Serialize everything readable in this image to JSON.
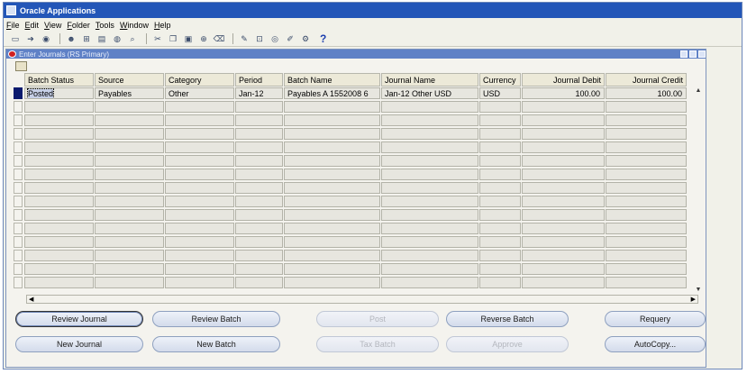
{
  "app": {
    "title": "Oracle Applications"
  },
  "menu": [
    "File",
    "Edit",
    "View",
    "Folder",
    "Tools",
    "Window",
    "Help"
  ],
  "toolbar": {
    "help_glyph": "?"
  },
  "form": {
    "title": "Enter Journals (RS Primary)",
    "columns": [
      "Batch Status",
      "Source",
      "Category",
      "Period",
      "Batch Name",
      "Journal Name",
      "Currency",
      "Journal Debit",
      "Journal Credit"
    ],
    "rows": [
      {
        "batch_status": "Posted",
        "source": "Payables",
        "category": "Other",
        "period": "Jan-12",
        "batch_name": "Payables A 1552008 6",
        "journal_name": "Jan-12 Other USD",
        "currency": "USD",
        "journal_debit": "100.00",
        "journal_credit": "100.00"
      }
    ]
  },
  "buttons": {
    "review_journal": "Review Journal",
    "review_batch": "Review Batch",
    "post": "Post",
    "reverse_batch": "Reverse Batch",
    "requery": "Requery",
    "new_journal": "New Journal",
    "new_batch": "New Batch",
    "tax_batch": "Tax Batch",
    "approve": "Approve",
    "autocopy": "AutoCopy..."
  }
}
